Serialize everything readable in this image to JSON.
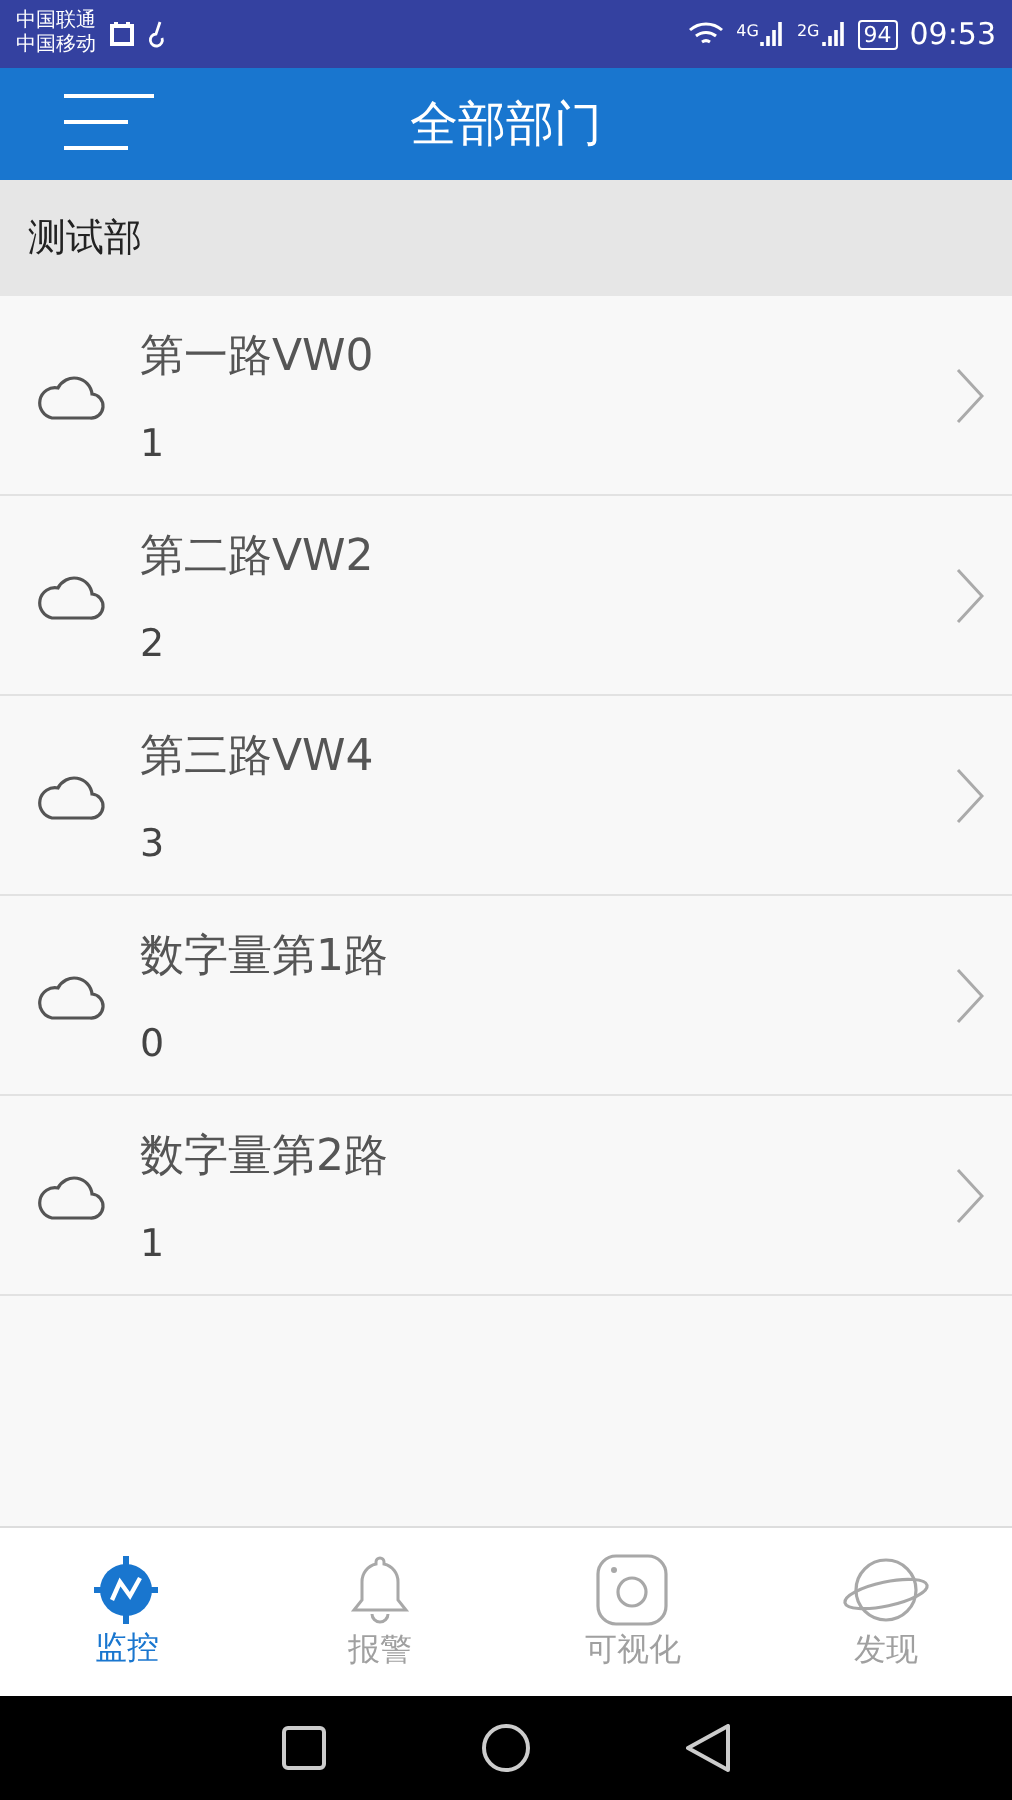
{
  "status_bar": {
    "carriers": [
      "中国联通",
      "中国移动"
    ],
    "networks": [
      "4G",
      "2G"
    ],
    "battery": "94",
    "time": "09:53"
  },
  "header": {
    "title": "全部部门"
  },
  "section": {
    "title": "测试部"
  },
  "rows": [
    {
      "name": "第一路VW0",
      "value": "1"
    },
    {
      "name": "第二路VW2",
      "value": "2"
    },
    {
      "name": "第三路VW4",
      "value": "3"
    },
    {
      "name": "数字量第1路",
      "value": "0"
    },
    {
      "name": "数字量第2路",
      "value": "1"
    }
  ],
  "tabs": [
    {
      "kind": "monitor",
      "label": "监控",
      "selected": true
    },
    {
      "kind": "alarm",
      "label": "报警",
      "selected": false
    },
    {
      "kind": "visual",
      "label": "可视化",
      "selected": false
    },
    {
      "kind": "discover",
      "label": "发现",
      "selected": false
    }
  ]
}
